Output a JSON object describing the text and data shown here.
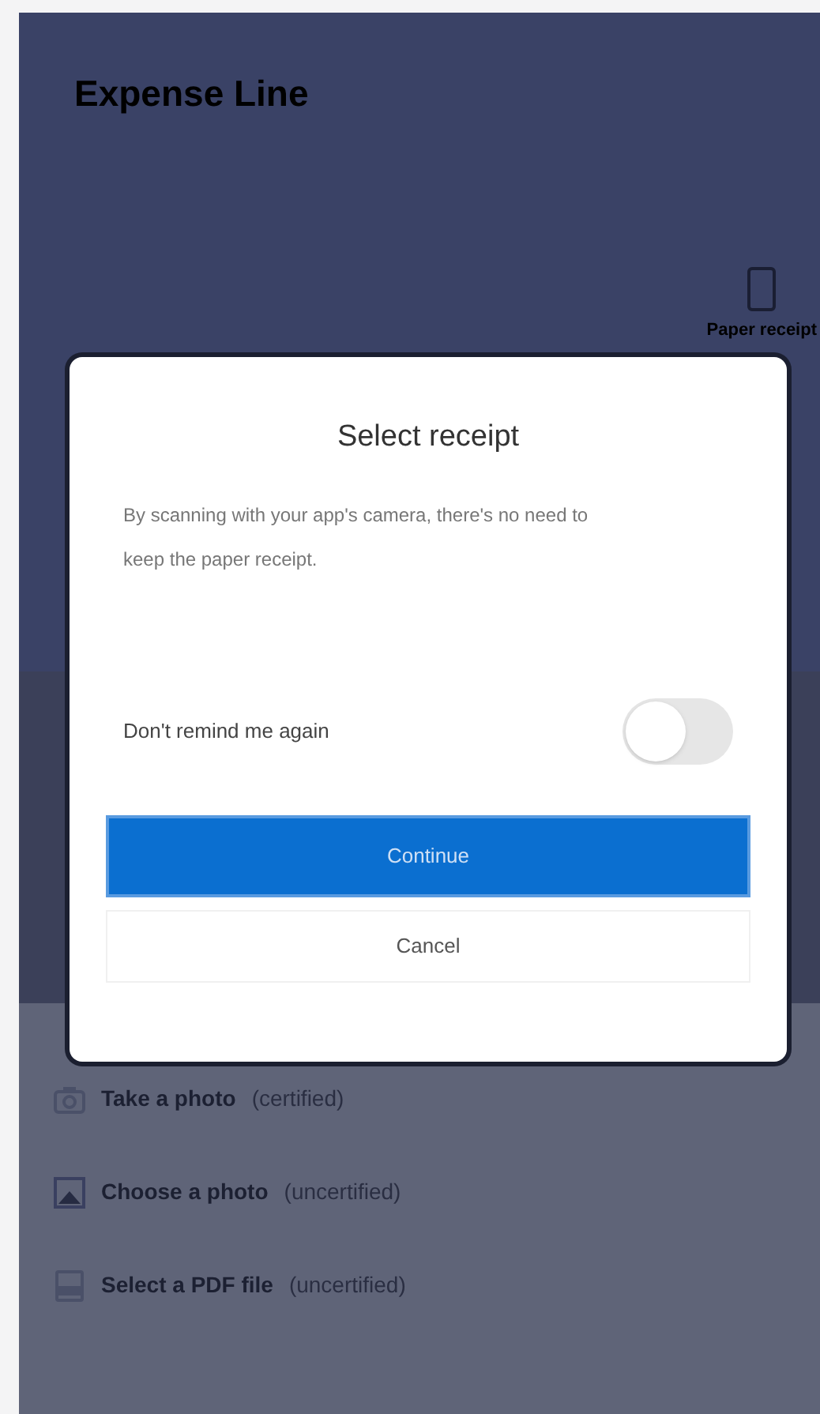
{
  "page": {
    "title": "Expense Line",
    "receipt_label": "Paper receipt"
  },
  "options": [
    {
      "kind": "camera",
      "label": "Take a photo",
      "note": "(certified)"
    },
    {
      "kind": "image",
      "label": "Choose a photo",
      "note": "(uncertified)"
    },
    {
      "kind": "pdf",
      "label": "Select a PDF file",
      "note": "(uncertified)"
    }
  ],
  "dialog": {
    "title": "Select receipt",
    "message": "By scanning with your app's camera, there's no need to keep the paper receipt.",
    "toggle": {
      "label": "Don't remind me again",
      "on": false
    },
    "buttons": [
      {
        "kind": "primary",
        "label": "Continue"
      },
      {
        "kind": "secondary",
        "label": "Cancel"
      }
    ]
  }
}
